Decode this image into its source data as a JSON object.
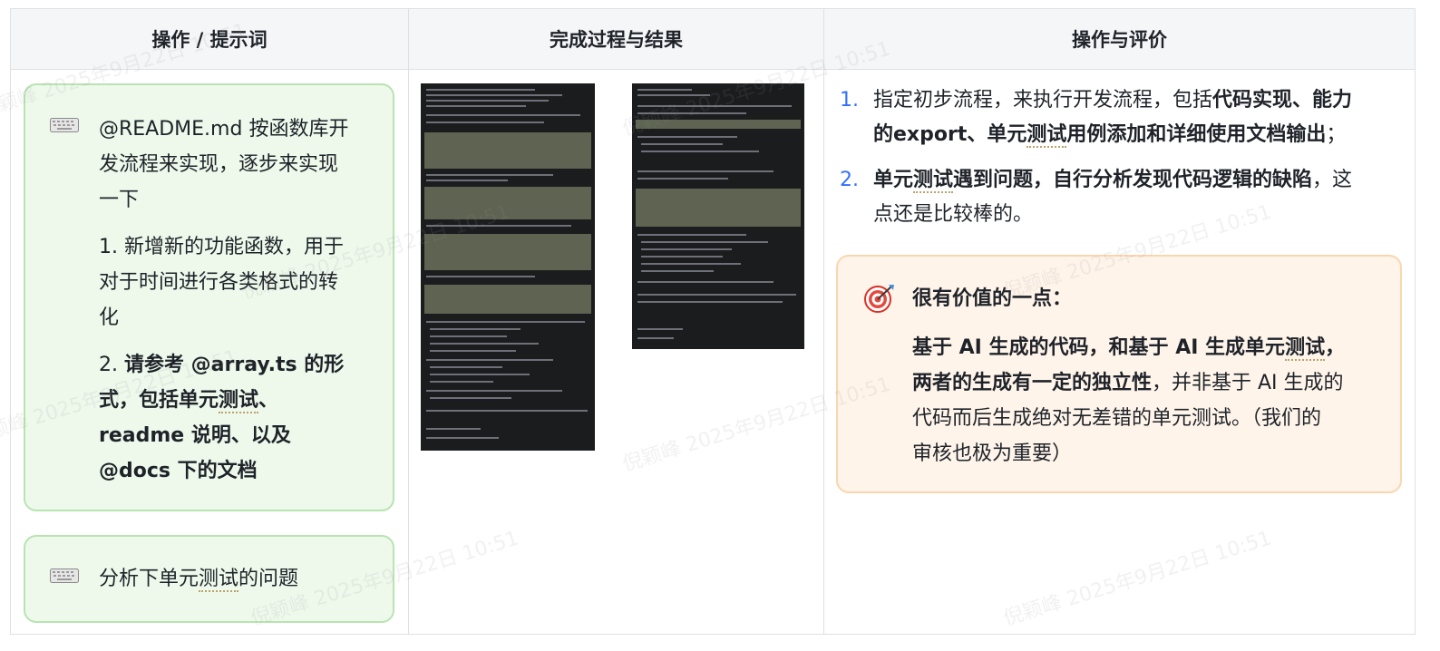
{
  "headers": [
    "操作 / 提示词",
    "完成过程与结果",
    "操作与评价"
  ],
  "prompt1": {
    "icon": "keyboard-icon",
    "line1": "@README.md  按函数库开",
    "line2": "发流程来实现，逐步来实现",
    "line3": "一下",
    "item1_l1": "1. 新增新的功能函数，用于",
    "item1_l2": "对于时间进行各类格式的转",
    "item1_l3": "化",
    "item2_prefix": "2. ",
    "item2_b1": "请参考 @array.ts 的形",
    "item2_b2": "式，包括单元",
    "item2_u": "测试",
    "item2_b3": "、",
    "item2_b4": "readme 说明、以及",
    "item2_b5": "@docs 下的文档"
  },
  "prompt2": {
    "icon": "keyboard-icon",
    "pre": "分析下单元",
    "u": "测试",
    "post": "的问题"
  },
  "evaluation": {
    "items": [
      {
        "num": "1.",
        "l1_plain": "指定初步流程，来执行开发流程，包括",
        "l1_bold": "代码实现、能力",
        "l2_bold_a": "的export、单元",
        "l2_u": "测试",
        "l2_bold_b": "用例添加和详细使用文档输出",
        "l2_plain": "；"
      },
      {
        "num": "2.",
        "l1_bold_a": "单元",
        "l1_u": "测试",
        "l1_bold_b": "遇到问题，自行分析发现代码逻辑的缺陷",
        "l1_plain": "，这",
        "l2_plain": "点还是比较棒的。"
      }
    ],
    "highlight": {
      "icon": "target-icon",
      "title": "很有价值的一点：",
      "l1_bold_a": "基于 AI 生成的代码，和基于 AI 生成单元",
      "l1_u": "测试",
      "l1_bold_b": "，",
      "l2_bold": "两者的生成有一定的独立性",
      "l2_plain": "，并非基于 AI 生成的",
      "l3": "代码而后生成绝对无差错的单元测试。（我们的",
      "l4": "审核也极为重要）"
    }
  },
  "watermark": "倪颖峰 2025年9月22日 10:51",
  "colors": {
    "accent": "#3370ff",
    "green_bg": "#eef9ec",
    "orange_bg": "#fef4ea",
    "header_bg": "#f5f6f7"
  }
}
